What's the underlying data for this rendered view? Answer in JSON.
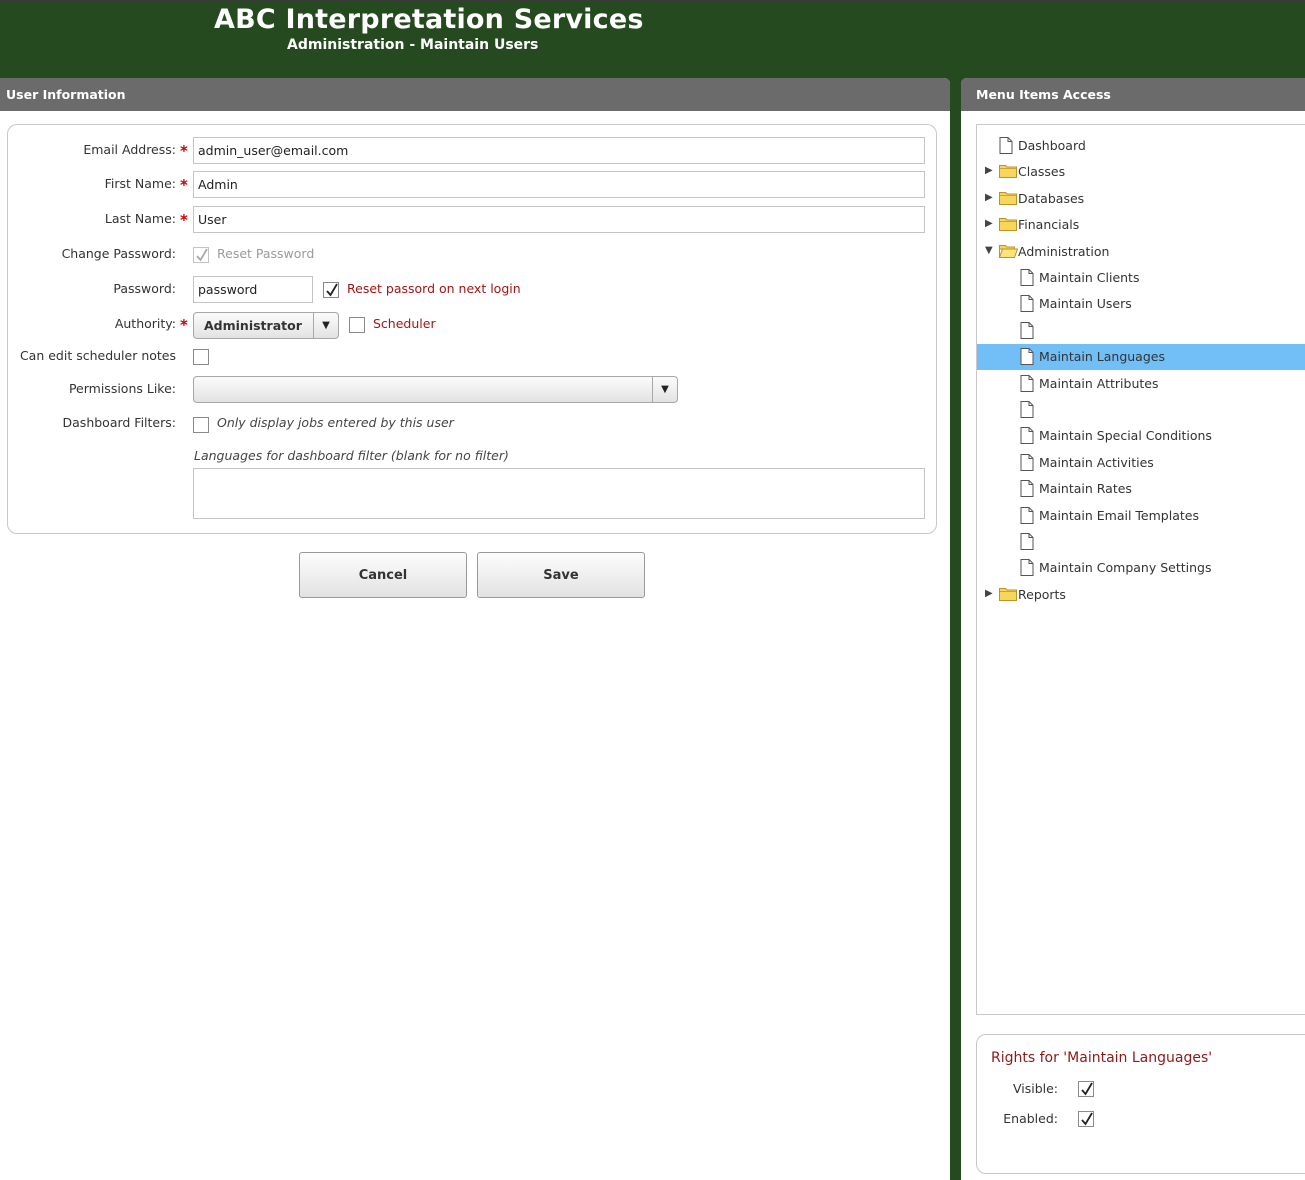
{
  "header": {
    "title": "ABC Interpretation Services",
    "subtitle": "Administration - Maintain Users"
  },
  "user_info": {
    "panel_title": "User Information",
    "email": {
      "label": "Email Address:",
      "value": "admin_user@email.com",
      "required": true
    },
    "first_name": {
      "label": "First Name:",
      "value": "Admin",
      "required": true
    },
    "last_name": {
      "label": "Last Name:",
      "value": "User",
      "required": true
    },
    "change_password": {
      "label": "Change Password:",
      "option_label": "Reset Password",
      "checked": true,
      "disabled": true
    },
    "password": {
      "label": "Password:",
      "value": "password",
      "reset_label": "Reset passord on next login",
      "reset_checked": true
    },
    "authority": {
      "label": "Authority:",
      "value": "Administrator",
      "required": true,
      "scheduler_label": "Scheduler",
      "scheduler_checked": false
    },
    "scheduler_notes": {
      "label": "Can edit scheduler notes",
      "checked": false
    },
    "permissions_like": {
      "label": "Permissions Like:",
      "value": ""
    },
    "dashboard_filters": {
      "label": "Dashboard Filters:",
      "option_label": "Only display jobs entered by this user",
      "checked": false
    },
    "languages_filter": {
      "label": "Languages for dashboard filter (blank for no filter)",
      "value": ""
    },
    "required_mark": "*",
    "dropdown_arrow": "▼"
  },
  "actions": {
    "cancel_label": "Cancel",
    "save_label": "Save"
  },
  "menu_access": {
    "panel_title": "Menu Items Access",
    "toggle_collapsed": "▶",
    "toggle_expanded": "▼",
    "items": [
      {
        "label": "Dashboard",
        "icon": "page-icon"
      },
      {
        "label": "Classes",
        "icon": "folder-icon",
        "expandable": true
      },
      {
        "label": "Databases",
        "icon": "folder-icon",
        "expandable": true
      },
      {
        "label": "Financials",
        "icon": "folder-icon",
        "expandable": true
      },
      {
        "label": "Administration",
        "icon": "folder-open-icon",
        "expanded": true
      },
      {
        "label": "Maintain Clients",
        "icon": "page-icon"
      },
      {
        "label": "Maintain Users",
        "icon": "page-icon"
      },
      {
        "label": "",
        "icon": "page-icon"
      },
      {
        "label": "Maintain Languages",
        "icon": "page-icon",
        "selected": true
      },
      {
        "label": "Maintain Attributes",
        "icon": "page-icon"
      },
      {
        "label": "",
        "icon": "page-icon"
      },
      {
        "label": "Maintain Special Conditions",
        "icon": "page-icon"
      },
      {
        "label": "Maintain Activities",
        "icon": "page-icon"
      },
      {
        "label": "Maintain Rates",
        "icon": "page-icon"
      },
      {
        "label": "Maintain Email Templates",
        "icon": "page-icon"
      },
      {
        "label": "",
        "icon": "page-icon"
      },
      {
        "label": "Maintain Company Settings",
        "icon": "page-icon"
      },
      {
        "label": "Reports",
        "icon": "folder-icon",
        "expandable": true
      }
    ],
    "selection_color": "#72bff7"
  },
  "rights": {
    "title": "Rights for 'Maintain Languages'",
    "visible": {
      "label": "Visible:",
      "checked": true
    },
    "enabled": {
      "label": "Enabled:",
      "checked": true
    }
  },
  "colors": {
    "background": "#264a1f",
    "panel_header": "#6b6b6b",
    "required": "#cc0000",
    "accent_text": "#8b1a1a"
  }
}
